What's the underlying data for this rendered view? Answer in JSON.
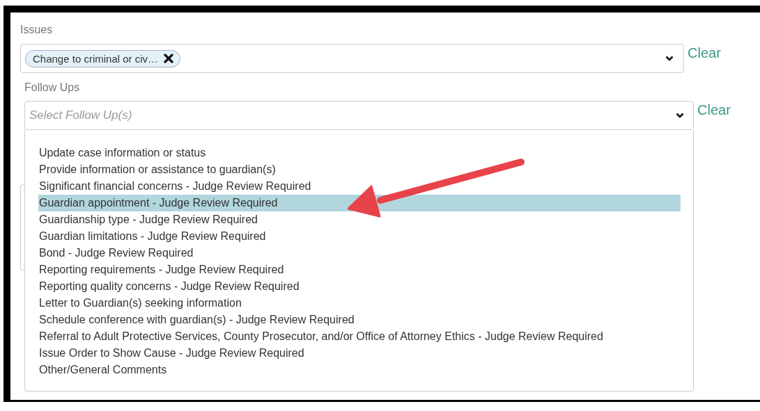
{
  "issues": {
    "label": "Issues",
    "tags": [
      {
        "text": "Change to criminal or civ…"
      }
    ],
    "clear": "Clear"
  },
  "follow_ups": {
    "label": "Follow Ups",
    "placeholder": "Select Follow Up(s)",
    "clear": "Clear",
    "expanded": true,
    "options": [
      {
        "label": "Update case information or status",
        "selected": false
      },
      {
        "label": "Provide information or assistance to guardian(s)",
        "selected": false
      },
      {
        "label": "Significant financial concerns - Judge Review Required",
        "selected": false
      },
      {
        "label": "Guardian appointment - Judge Review Required",
        "selected": true
      },
      {
        "label": "Guardianship type - Judge Review Required",
        "selected": false
      },
      {
        "label": "Guardian limitations - Judge Review Required",
        "selected": false
      },
      {
        "label": "Bond - Judge Review Required",
        "selected": false
      },
      {
        "label": "Reporting requirements - Judge Review Required",
        "selected": false
      },
      {
        "label": "Reporting quality concerns - Judge Review Required",
        "selected": false
      },
      {
        "label": "Letter to Guardian(s) seeking information",
        "selected": false
      },
      {
        "label": "Schedule conference with guardian(s) - Judge Review Required",
        "selected": false
      },
      {
        "label": "Referral to Adult Protective Services, County Prosecutor, and/or Office of Attorney Ethics - Judge Review Required",
        "selected": false
      },
      {
        "label": "Issue Order to Show Cause - Judge Review Required",
        "selected": false
      },
      {
        "label": "Other/General Comments",
        "selected": false
      }
    ]
  }
}
